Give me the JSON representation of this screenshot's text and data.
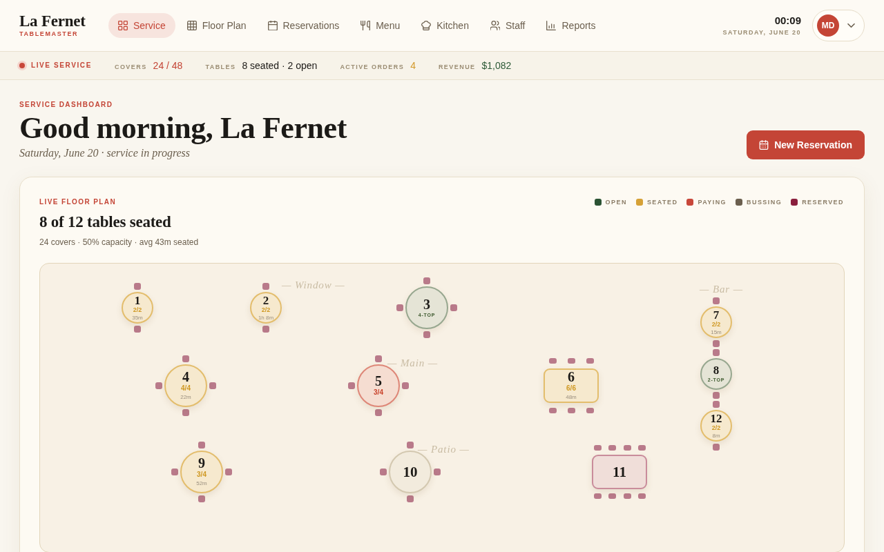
{
  "brand": {
    "name": "La Fernet",
    "tagline": "TABLEMASTER"
  },
  "nav": [
    {
      "label": "Service",
      "selected": true
    },
    {
      "label": "Floor Plan",
      "selected": false
    },
    {
      "label": "Reservations",
      "selected": false
    },
    {
      "label": "Menu",
      "selected": false
    },
    {
      "label": "Kitchen",
      "selected": false
    },
    {
      "label": "Staff",
      "selected": false
    },
    {
      "label": "Reports",
      "selected": false
    }
  ],
  "clock": {
    "time": "00:09",
    "date": "SATURDAY, JUNE 20"
  },
  "user": {
    "initials": "MD"
  },
  "status_bar": {
    "live": "LIVE SERVICE",
    "stats": [
      {
        "label": "COVERS",
        "value": "24 / 48",
        "color": "#c44536"
      },
      {
        "label": "TABLES",
        "value": "8 seated · 2 open",
        "color": "#1c1a17"
      },
      {
        "label": "ACTIVE ORDERS",
        "value": "4",
        "color": "#d39a2c"
      },
      {
        "label": "REVENUE",
        "value": "$1,082",
        "color": "#2d5a37"
      }
    ]
  },
  "header": {
    "eyebrow": "SERVICE DASHBOARD",
    "title": "Good morning, La Fernet",
    "subtitle": "Saturday, June 20 · service in progress",
    "action": "New Reservation"
  },
  "floor_plan": {
    "eyebrow": "LIVE FLOOR PLAN",
    "title": "8 of 12 tables seated",
    "summary": "24 covers · 50% capacity · avg 43m seated",
    "legend": [
      {
        "label": "OPEN",
        "color": "#2b5233"
      },
      {
        "label": "SEATED",
        "color": "#d6a136"
      },
      {
        "label": "PAYING",
        "color": "#c8473a"
      },
      {
        "label": "BUSSING",
        "color": "#6b5f4e"
      },
      {
        "label": "RESERVED",
        "color": "#8a1f3d"
      }
    ],
    "zones": [
      {
        "label": "— Window —"
      },
      {
        "label": "— Main —"
      },
      {
        "label": "— Patio —"
      },
      {
        "label": "— Bar —"
      }
    ],
    "tables": [
      {
        "number": "1",
        "kind": "two-top",
        "color": "#e3bd6c",
        "guests": "2/2",
        "time": "35m"
      },
      {
        "number": "2",
        "kind": "two-top",
        "color": "#e3bd6c",
        "guests": "2/2",
        "time": "1h 8m"
      },
      {
        "number": "3",
        "kind": "four-top",
        "color": "#97a78f",
        "capacity": "4-TOP"
      },
      {
        "number": "7",
        "kind": "two-top",
        "color": "#e3bd6c",
        "guests": "2/2",
        "time": "15m"
      },
      {
        "number": "4",
        "kind": "four-top",
        "color": "#e3bd6c",
        "guests": "4/4",
        "time": "22m"
      },
      {
        "number": "5",
        "kind": "four-top",
        "color": "#de8677",
        "guests": "3/4"
      },
      {
        "number": "6",
        "kind": "six-top",
        "color": "#e3bd6c",
        "guests": "6/6",
        "time": "48m"
      },
      {
        "number": "8",
        "kind": "two-top",
        "color": "#97a78f",
        "capacity": "2-TOP"
      },
      {
        "number": "12",
        "kind": "two-top",
        "color": "#e3bd6c",
        "guests": "2/2",
        "time": "8m"
      },
      {
        "number": "9",
        "kind": "four-top",
        "color": "#e3bd6c",
        "guests": "3/4",
        "time": "52m"
      },
      {
        "number": "10",
        "kind": "four-top",
        "color": "#d3c8b0"
      },
      {
        "number": "11",
        "kind": "eight-top",
        "color": "#c98c9b"
      }
    ]
  }
}
